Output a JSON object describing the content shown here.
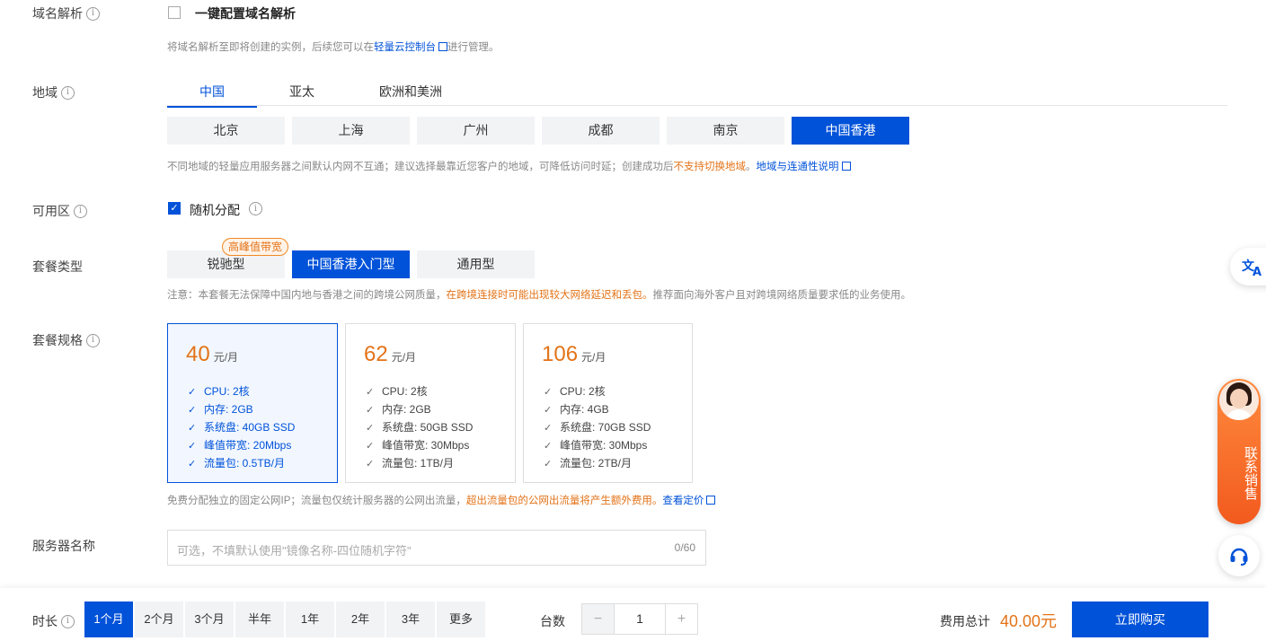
{
  "dns": {
    "label": "域名解析",
    "checkbox_label": "一键配置域名解析",
    "hint_prefix": "将域名解析至即将创建的实例，后续您可以在",
    "hint_link": "轻量云控制台",
    "hint_suffix": "进行管理。"
  },
  "region": {
    "label": "地域",
    "tabs": [
      "中国",
      "亚太",
      "欧洲和美洲"
    ],
    "cities": [
      "北京",
      "上海",
      "广州",
      "成都",
      "南京",
      "中国香港"
    ],
    "selected_city": "中国香港",
    "hint_prefix": "不同地域的轻量应用服务器之间默认内网不互通；建议选择最靠近您客户的地域，可降低访问时延；创建成功后",
    "hint_warn": "不支持切换地域",
    "hint_sep": "。",
    "hint_link": "地域与连通性说明"
  },
  "zone": {
    "label": "可用区",
    "checkbox_label": "随机分配"
  },
  "package_type": {
    "label": "套餐类型",
    "badge": "高峰值带宽",
    "options": [
      "锐驰型",
      "中国香港入门型",
      "通用型"
    ],
    "hint_prefix": "注意：本套餐无法保障中国内地与香港之间的跨境公网质量，",
    "hint_warn": "在跨境连接时可能出现较大网络延迟和丢包。",
    "hint_suffix": "推荐面向海外客户且对跨境网络质量要求低的业务使用。"
  },
  "package_spec": {
    "label": "套餐规格",
    "unit": "元/月",
    "cards": [
      {
        "price": "40",
        "features": [
          "CPU: 2核",
          "内存: 2GB",
          "系统盘: 40GB SSD",
          "峰值带宽: 20Mbps",
          "流量包: 0.5TB/月"
        ]
      },
      {
        "price": "62",
        "features": [
          "CPU: 2核",
          "内存: 2GB",
          "系统盘: 50GB SSD",
          "峰值带宽: 30Mbps",
          "流量包: 1TB/月"
        ]
      },
      {
        "price": "106",
        "features": [
          "CPU: 2核",
          "内存: 4GB",
          "系统盘: 70GB SSD",
          "峰值带宽: 30Mbps",
          "流量包: 2TB/月"
        ]
      }
    ],
    "hint_prefix": "免费分配独立的固定公网IP；流量包仅统计服务器的公网出流量，",
    "hint_warn": "超出流量包的公网出流量将产生额外费用。",
    "hint_link": "查看定价"
  },
  "server_name": {
    "label": "服务器名称",
    "placeholder": "可选，不填默认使用\"镜像名称-四位随机字符\"",
    "counter": "0/60"
  },
  "bottom": {
    "duration_label": "时长",
    "durations": [
      "1个月",
      "2个月",
      "3个月",
      "半年",
      "1年",
      "2年",
      "3年",
      "更多"
    ],
    "quantity_label": "台数",
    "quantity": "1",
    "minus": "−",
    "plus": "+",
    "total_label": "费用总计",
    "total": "40.00元",
    "buy": "立即购买"
  },
  "side_panel": {
    "contact": "联系销售",
    "translate_icon": "translate-icon",
    "support_icon": "headset-icon"
  },
  "colors": {
    "accent": "#0052d9",
    "warn": "#e37318"
  }
}
